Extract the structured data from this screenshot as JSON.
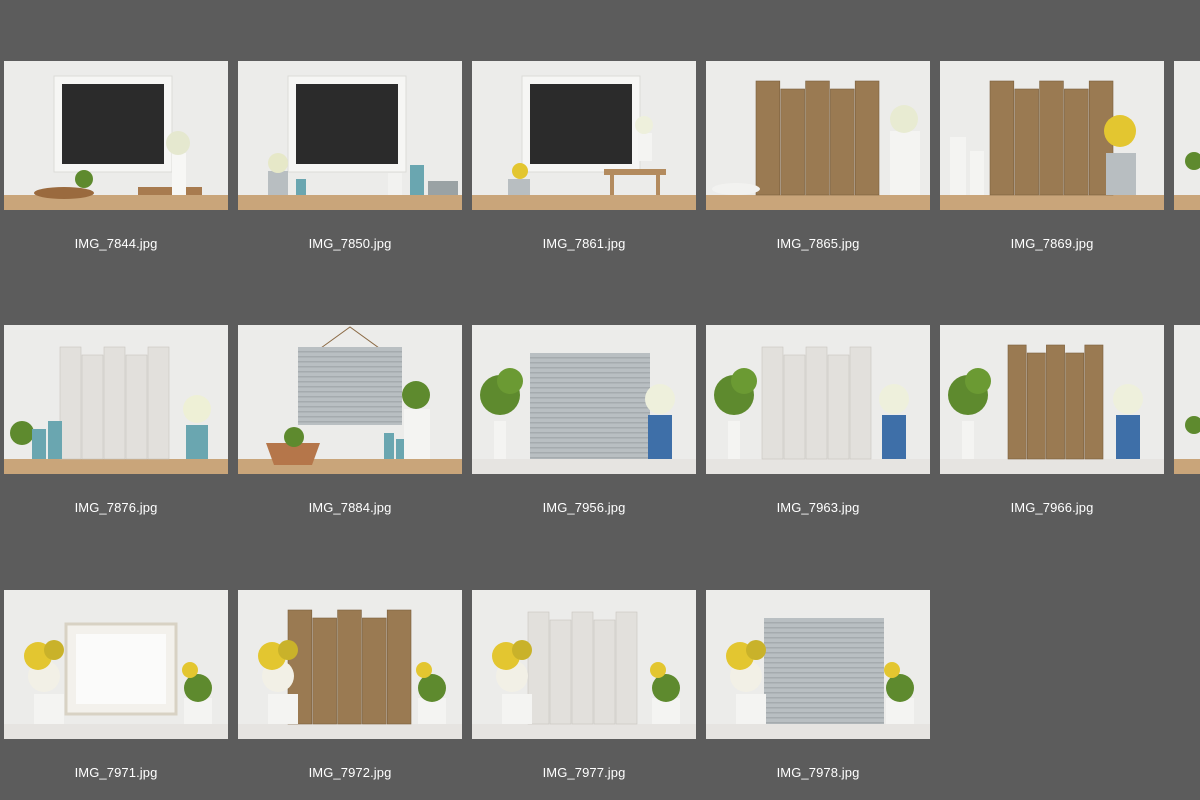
{
  "files": [
    {
      "name": "IMG_7844.jpg",
      "scene": "chalkboard",
      "decor": "wood-table-bowl",
      "icon": "image-thumbnail"
    },
    {
      "name": "IMG_7850.jpg",
      "scene": "chalkboard",
      "decor": "pitchers-jars",
      "icon": "image-thumbnail"
    },
    {
      "name": "IMG_7861.jpg",
      "scene": "chalkboard",
      "decor": "stool-pitcher",
      "icon": "image-thumbnail"
    },
    {
      "name": "IMG_7865.jpg",
      "scene": "wood-pallet-brown",
      "decor": "white-pitcher",
      "icon": "image-thumbnail"
    },
    {
      "name": "IMG_7869.jpg",
      "scene": "wood-pallet-brown",
      "decor": "candles-pitcher",
      "icon": "image-thumbnail"
    },
    {
      "name": "",
      "scene": "partial",
      "decor": "",
      "icon": "image-thumbnail"
    },
    {
      "name": "IMG_7876.jpg",
      "scene": "wood-pallet-white",
      "decor": "blue-jars",
      "icon": "image-thumbnail"
    },
    {
      "name": "IMG_7884.jpg",
      "scene": "metal-sign-hanging",
      "decor": "pot-jars",
      "icon": "image-thumbnail"
    },
    {
      "name": "IMG_7956.jpg",
      "scene": "metal-sign-wide",
      "decor": "topiary-blue-vase",
      "icon": "image-thumbnail"
    },
    {
      "name": "IMG_7963.jpg",
      "scene": "wood-pallet-white",
      "decor": "topiary-blue-vase",
      "icon": "image-thumbnail"
    },
    {
      "name": "IMG_7966.jpg",
      "scene": "wood-pallet-brown-small",
      "decor": "topiary-blue-vase",
      "icon": "image-thumbnail"
    },
    {
      "name": "",
      "scene": "partial",
      "decor": "",
      "icon": "image-thumbnail"
    },
    {
      "name": "IMG_7971.jpg",
      "scene": "white-frame",
      "decor": "yellow-flowers",
      "icon": "image-thumbnail"
    },
    {
      "name": "IMG_7972.jpg",
      "scene": "wood-pallet-brown",
      "decor": "yellow-flowers",
      "icon": "image-thumbnail"
    },
    {
      "name": "IMG_7977.jpg",
      "scene": "wood-pallet-white",
      "decor": "yellow-flowers",
      "icon": "image-thumbnail"
    },
    {
      "name": "IMG_7978.jpg",
      "scene": "metal-sign-wide",
      "decor": "yellow-flowers",
      "icon": "image-thumbnail"
    }
  ],
  "colors": {
    "background": "#5c5c5c",
    "caption": "#ffffff",
    "wall": "#ececea",
    "wood_brown": "#9a7a52",
    "wood_white": "#e2e0dc",
    "metal": "#b9bfc2",
    "chalkboard": "#2b2b2b",
    "greenery": "#5e8a2e",
    "yellow_flower": "#e3c630",
    "shelf_wood": "#c9a57a",
    "shelf_white": "#e6e4e1",
    "blue_glass": "#6aa6b0"
  }
}
